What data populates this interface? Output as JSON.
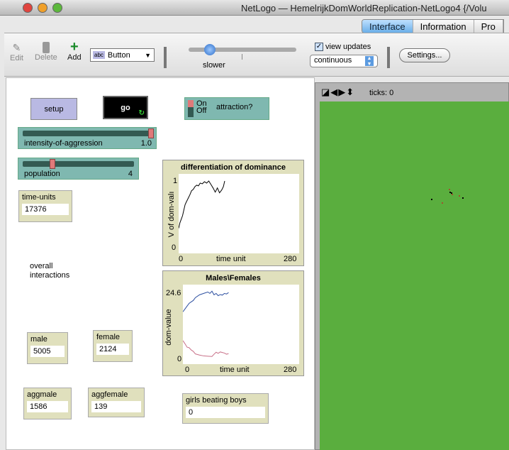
{
  "window": {
    "title": "NetLogo — HemelrijkDomWorldReplication-NetLogo4 {/Volu"
  },
  "tabs": [
    {
      "label": "Interface",
      "active": true
    },
    {
      "label": "Information"
    },
    {
      "label": "Pro"
    }
  ],
  "toolbar": {
    "edit": "Edit",
    "delete": "Delete",
    "add": "Add",
    "widget_type": "Button",
    "widget_icon": "abc",
    "speed_label": "slower",
    "speed": 0.15,
    "view_updates_label": "view updates",
    "view_updates_checked": true,
    "update_mode": "continuous",
    "settings": "Settings..."
  },
  "widgets": {
    "setup": "setup",
    "go": "go",
    "attraction": {
      "on": "On",
      "off": "Off",
      "label": "attraction?"
    },
    "aggression": {
      "label": "intensity-of-aggression",
      "value": "1.0",
      "fraction": 1.0
    },
    "population": {
      "label": "population",
      "value": "4",
      "fraction": 0.25
    },
    "time_units": {
      "label": "time-units",
      "value": "17376"
    },
    "overall": "overall\ninteractions",
    "male": {
      "label": "male",
      "value": "5005"
    },
    "female": {
      "label": "female",
      "value": "2124"
    },
    "aggmale": {
      "label": "aggmale",
      "value": "1586"
    },
    "aggfemale": {
      "label": "aggfemale",
      "value": "139"
    },
    "girls": {
      "label": "girls beating boys",
      "value": "0"
    }
  },
  "view": {
    "ticks": "ticks: 0",
    "background": "#5aae3e"
  },
  "chart_data": [
    {
      "type": "line",
      "title": "differentiation of dominance",
      "xlabel": "time unit",
      "ylabel": "V of dom-valı",
      "xlim": [
        0,
        280
      ],
      "ylim": [
        0,
        1
      ],
      "xticks": [
        "0",
        "280"
      ],
      "yticks": [
        "0",
        "1"
      ],
      "series": [
        {
          "color": "#000000",
          "x": [
            0,
            3,
            6,
            9,
            12,
            15,
            18,
            22,
            26,
            30,
            34,
            38,
            42,
            46,
            50,
            55,
            60,
            65,
            70,
            75,
            80,
            85,
            90,
            95,
            100,
            104,
            107
          ],
          "y": [
            0.32,
            0.4,
            0.45,
            0.5,
            0.58,
            0.66,
            0.7,
            0.75,
            0.8,
            0.86,
            0.88,
            0.92,
            0.94,
            0.93,
            0.97,
            0.96,
            0.99,
            0.97,
            1.0,
            0.95,
            0.9,
            0.84,
            0.9,
            0.83,
            0.87,
            0.92,
            1.0
          ]
        }
      ]
    },
    {
      "type": "line",
      "title": "Males\\Females",
      "xlabel": "time unit",
      "ylabel": "dom-value",
      "xlim": [
        0,
        280
      ],
      "ylim": [
        0,
        24.6
      ],
      "xticks": [
        "0",
        "280"
      ],
      "yticks": [
        "0",
        "24.6"
      ],
      "series": [
        {
          "color": "#2c4fa0",
          "x": [
            0,
            5,
            10,
            15,
            20,
            25,
            30,
            40,
            50,
            60,
            65,
            70,
            75,
            80,
            85,
            90,
            95,
            100,
            105,
            110
          ],
          "y": [
            17.5,
            18.5,
            19.5,
            20.5,
            21,
            21.5,
            22.5,
            23.5,
            24,
            24.5,
            24,
            24.8,
            23.5,
            24,
            23.2,
            23.6,
            23.4,
            24,
            23.8,
            24.3
          ]
        },
        {
          "color": "#c87088",
          "x": [
            0,
            5,
            10,
            15,
            20,
            25,
            30,
            40,
            50,
            60,
            70,
            75,
            80,
            85,
            90,
            95,
            100,
            105,
            110
          ],
          "y": [
            7.3,
            6.2,
            5,
            4.8,
            4,
            3.5,
            2.6,
            2.2,
            1.9,
            1.8,
            1.7,
            2.5,
            3.2,
            2.8,
            3.3,
            3.1,
            2.9,
            2.5,
            2.7
          ]
        }
      ]
    }
  ]
}
